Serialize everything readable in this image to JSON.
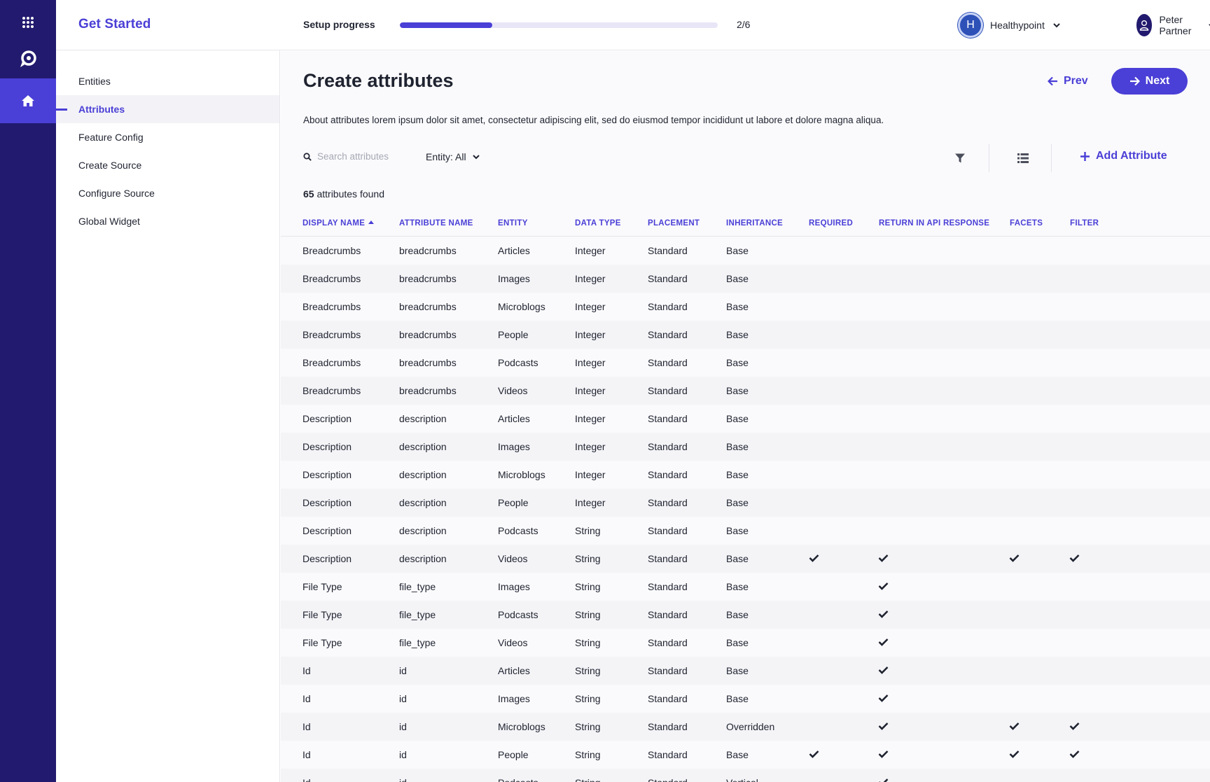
{
  "rail": {
    "items": [
      {
        "icon": "grid-icon"
      },
      {
        "icon": "logo-icon"
      },
      {
        "icon": "home-icon",
        "active": true
      }
    ]
  },
  "header": {
    "title": "Get Started",
    "progress_label": "Setup progress",
    "progress_value": 0.29,
    "progress_count": "2/6",
    "org": {
      "initial": "H",
      "name": "Healthypoint"
    },
    "user": {
      "name": "Peter Partner"
    }
  },
  "steps": [
    {
      "label": "Entities"
    },
    {
      "label": "Attributes",
      "active": true
    },
    {
      "label": "Feature Config"
    },
    {
      "label": "Create Source"
    },
    {
      "label": "Configure Source"
    },
    {
      "label": "Global Widget"
    }
  ],
  "main": {
    "title": "Create attributes",
    "prev_label": "Prev",
    "next_label": "Next",
    "about": "About attributes lorem ipsum dolor sit amet, consectetur adipiscing elit, sed do eiusmod tempor incididunt ut labore et dolore magna aliqua.",
    "search_placeholder": "Search attributes",
    "entity_filter": "Entity: All",
    "add_label": "Add Attribute",
    "found_count": "65",
    "found_label": "attributes found"
  },
  "colors": {
    "accent": "#4a3fd6",
    "rail": "#221a6e",
    "rail_active": "#4a3fd6"
  },
  "table": {
    "columns": [
      "Display Name",
      "Attribute Name",
      "Entity",
      "Data Type",
      "Placement",
      "Inheritance",
      "Required",
      "Return in API response",
      "Facets",
      "Filter"
    ],
    "rows": [
      [
        "Breadcrumbs",
        "breadcrumbs",
        "Articles",
        "Integer",
        "Standard",
        "Base",
        false,
        false,
        false,
        false
      ],
      [
        "Breadcrumbs",
        "breadcrumbs",
        "Images",
        "Integer",
        "Standard",
        "Base",
        false,
        false,
        false,
        false
      ],
      [
        "Breadcrumbs",
        "breadcrumbs",
        "Microblogs",
        "Integer",
        "Standard",
        "Base",
        false,
        false,
        false,
        false
      ],
      [
        "Breadcrumbs",
        "breadcrumbs",
        "People",
        "Integer",
        "Standard",
        "Base",
        false,
        false,
        false,
        false
      ],
      [
        "Breadcrumbs",
        "breadcrumbs",
        "Podcasts",
        "Integer",
        "Standard",
        "Base",
        false,
        false,
        false,
        false
      ],
      [
        "Breadcrumbs",
        "breadcrumbs",
        "Videos",
        "Integer",
        "Standard",
        "Base",
        false,
        false,
        false,
        false
      ],
      [
        "Description",
        "description",
        "Articles",
        "Integer",
        "Standard",
        "Base",
        false,
        false,
        false,
        false
      ],
      [
        "Description",
        "description",
        "Images",
        "Integer",
        "Standard",
        "Base",
        false,
        false,
        false,
        false
      ],
      [
        "Description",
        "description",
        "Microblogs",
        "Integer",
        "Standard",
        "Base",
        false,
        false,
        false,
        false
      ],
      [
        "Description",
        "description",
        "People",
        "Integer",
        "Standard",
        "Base",
        false,
        false,
        false,
        false
      ],
      [
        "Description",
        "description",
        "Podcasts",
        "String",
        "Standard",
        "Base",
        false,
        false,
        false,
        false
      ],
      [
        "Description",
        "description",
        "Videos",
        "String",
        "Standard",
        "Base",
        true,
        true,
        true,
        true
      ],
      [
        "File Type",
        "file_type",
        "Images",
        "String",
        "Standard",
        "Base",
        false,
        true,
        false,
        false
      ],
      [
        "File Type",
        "file_type",
        "Podcasts",
        "String",
        "Standard",
        "Base",
        false,
        true,
        false,
        false
      ],
      [
        "File Type",
        "file_type",
        "Videos",
        "String",
        "Standard",
        "Base",
        false,
        true,
        false,
        false
      ],
      [
        "Id",
        "id",
        "Articles",
        "String",
        "Standard",
        "Base",
        false,
        true,
        false,
        false
      ],
      [
        "Id",
        "id",
        "Images",
        "String",
        "Standard",
        "Base",
        false,
        true,
        false,
        false
      ],
      [
        "Id",
        "id",
        "Microblogs",
        "String",
        "Standard",
        "Overridden",
        false,
        true,
        true,
        true
      ],
      [
        "Id",
        "id",
        "People",
        "String",
        "Standard",
        "Base",
        true,
        true,
        true,
        true
      ],
      [
        "Id",
        "id",
        "Podcasts",
        "String",
        "Standard",
        "Vertical",
        false,
        true,
        false,
        false
      ]
    ]
  }
}
